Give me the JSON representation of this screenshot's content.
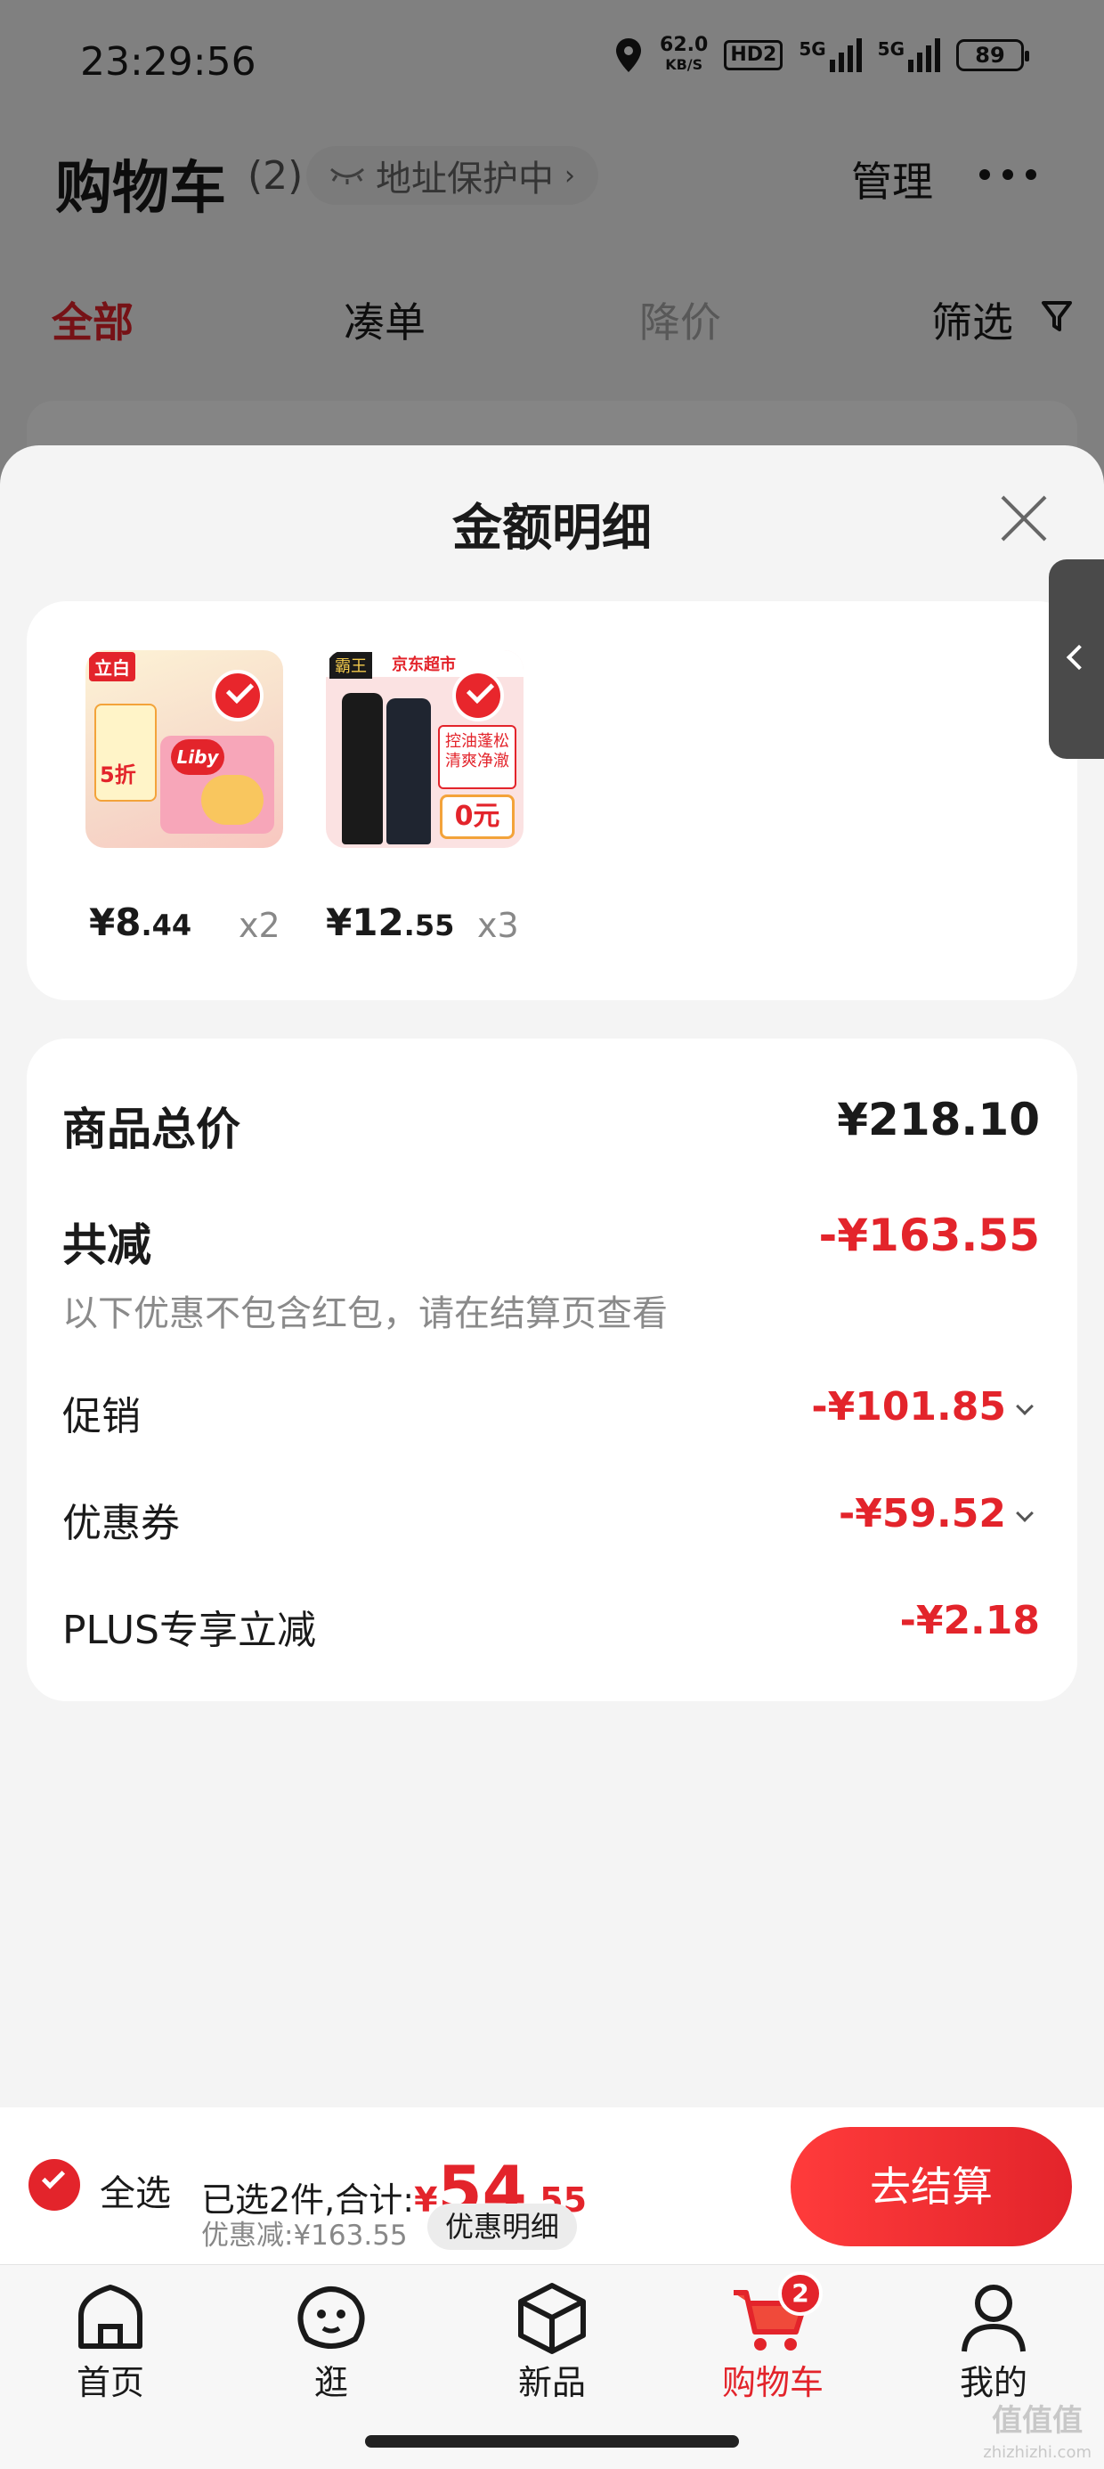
{
  "status_bar": {
    "time": "23:29:56",
    "net_speed": "62.0",
    "net_unit": "KB/S",
    "hd": "HD2",
    "signal1": "5G",
    "signal2": "5G",
    "battery": "89"
  },
  "header": {
    "title": "购物车",
    "count": "(2)",
    "address": "地址保护中",
    "manage": "管理"
  },
  "tabs": [
    {
      "label": "全部"
    },
    {
      "label": "凑单"
    },
    {
      "label": "降价"
    },
    {
      "label": "筛选"
    }
  ],
  "sheet": {
    "title": "金额明细",
    "products": [
      {
        "price_main": "¥8",
        "price_dec": ".44",
        "qty": "x2",
        "brand": "立白",
        "logo": "Liby",
        "badge": "5折"
      },
      {
        "price_main": "¥12",
        "price_dec": ".55",
        "qty": "x3",
        "brand": "霸王",
        "store": "京东超市",
        "slogan1": "控油蓬松",
        "slogan2": "清爽净澈",
        "badge": "0元"
      }
    ],
    "summary": {
      "total_label": "商品总价",
      "total_value": "¥218.10",
      "reduce_label": "共减",
      "reduce_value": "-¥163.55",
      "note": "以下优惠不包含红包，请在结算页查看",
      "items": [
        {
          "label": "促销",
          "value": "-¥101.85"
        },
        {
          "label": "优惠券",
          "value": "-¥59.52"
        },
        {
          "label": "PLUS专享立减",
          "value": "-¥2.18"
        }
      ]
    }
  },
  "checkout": {
    "select_all": "全选",
    "selected_text": "已选2件,合计:",
    "currency": "¥",
    "total_main": "54",
    "total_dec": ".55",
    "discount_text": "优惠减:¥163.55",
    "detail_btn": "优惠明细",
    "pay_btn": "去结算"
  },
  "nav": [
    {
      "label": "首页"
    },
    {
      "label": "逛"
    },
    {
      "label": "新品"
    },
    {
      "label": "购物车",
      "badge": "2"
    },
    {
      "label": "我的"
    }
  ],
  "watermark": {
    "text": "值值值",
    "sub": "zhizhizhi.com"
  },
  "colors": {
    "accent": "#e3242b"
  }
}
